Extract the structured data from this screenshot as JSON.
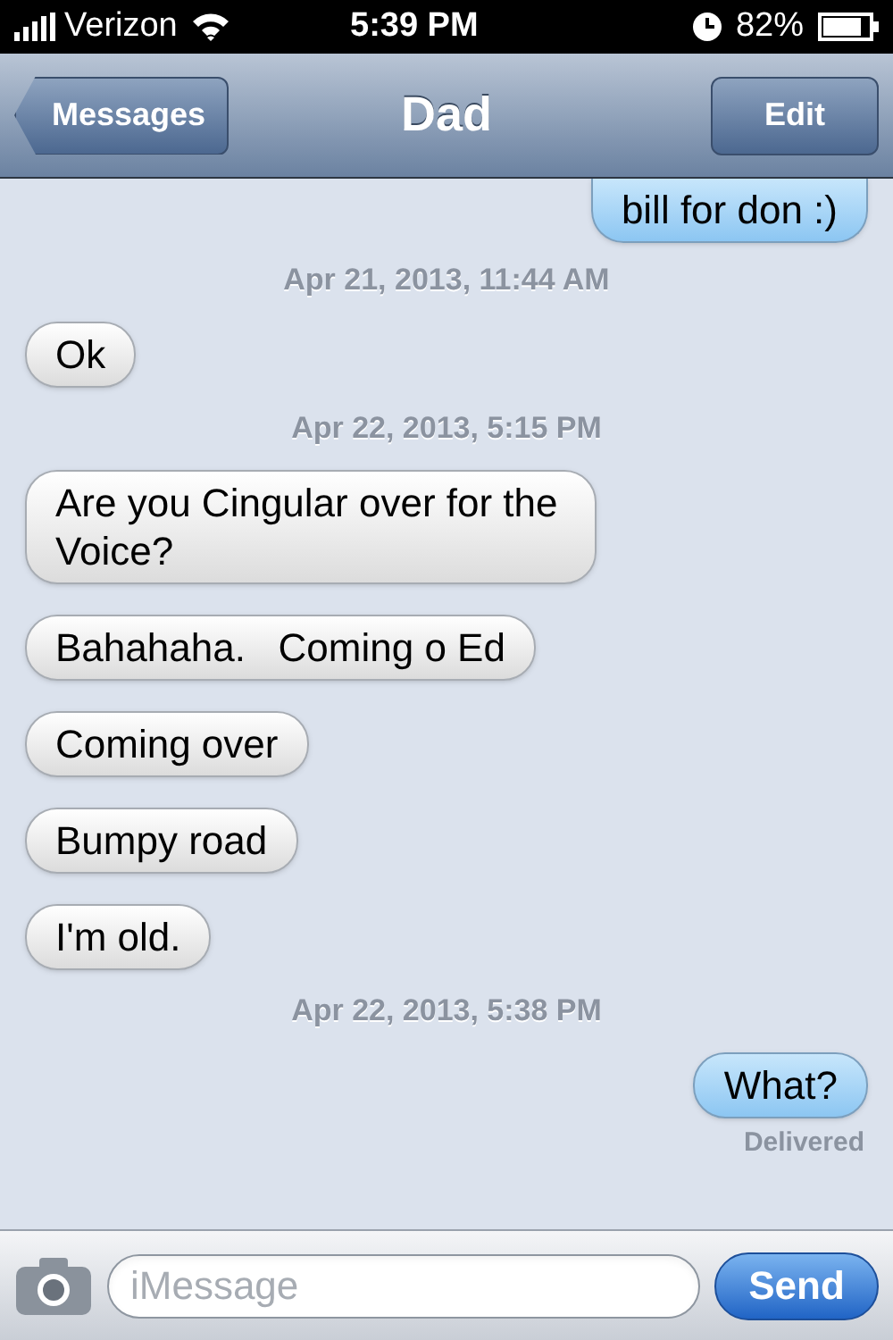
{
  "status_bar": {
    "carrier": "Verizon",
    "time": "5:39 PM",
    "battery": "82%"
  },
  "nav": {
    "back": "Messages",
    "title": "Dad",
    "edit": "Edit"
  },
  "messages": [
    {
      "kind": "sent",
      "text": "bill for don :)"
    },
    {
      "kind": "timestamp",
      "text": "Apr 21, 2013, 11:44 AM"
    },
    {
      "kind": "received",
      "text": "Ok"
    },
    {
      "kind": "timestamp",
      "text": "Apr 22, 2013, 5:15 PM"
    },
    {
      "kind": "received",
      "text": "Are you Cingular over for the Voice?"
    },
    {
      "kind": "received",
      "text": "Bahahaha.   Coming o Ed"
    },
    {
      "kind": "received",
      "text": "Coming over"
    },
    {
      "kind": "received",
      "text": "Bumpy road"
    },
    {
      "kind": "received",
      "text": "I'm old."
    },
    {
      "kind": "timestamp",
      "text": "Apr 22, 2013, 5:38 PM"
    },
    {
      "kind": "sent",
      "text": "What?"
    },
    {
      "kind": "status",
      "text": "Delivered"
    }
  ],
  "composer": {
    "placeholder": "iMessage",
    "send": "Send"
  }
}
